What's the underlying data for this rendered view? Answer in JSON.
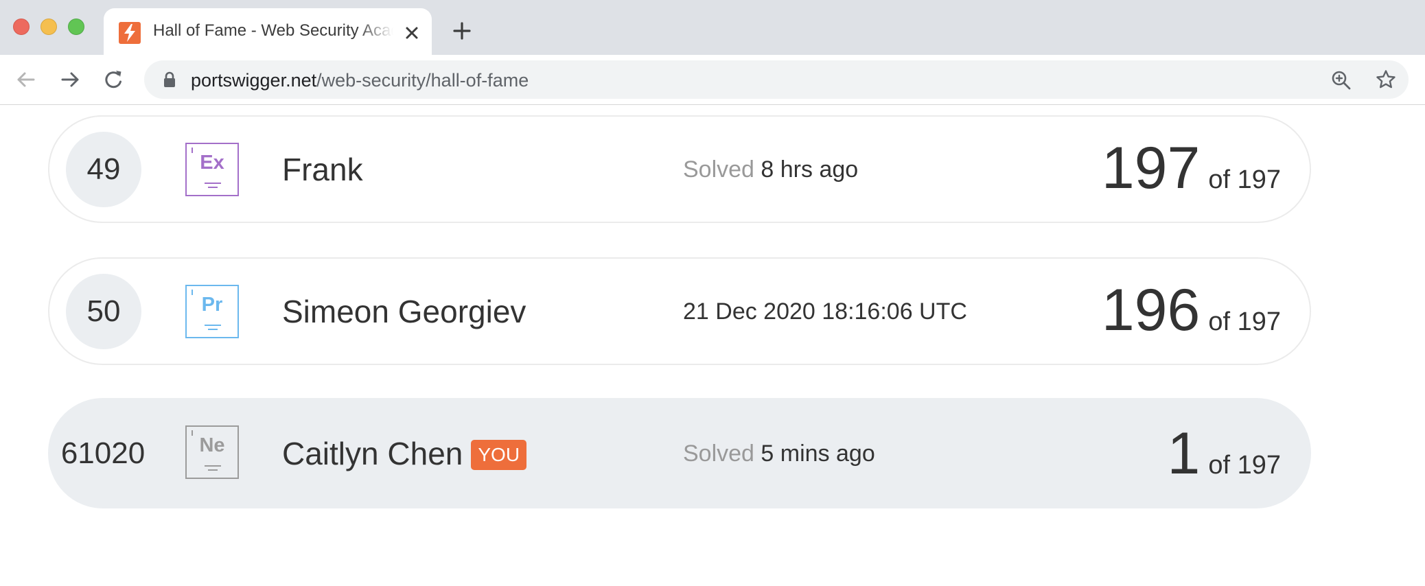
{
  "browser": {
    "tab": {
      "title": "Hall of Fame - Web Security Academy",
      "favicon": "portswigger-icon",
      "accent": "#ee6e3b"
    },
    "address": {
      "host": "portswigger.net",
      "path": "/web-security/hall-of-fame"
    }
  },
  "leaderboard": {
    "rows": [
      {
        "rank": "49",
        "level": {
          "symbol": "Ex",
          "color": "#a36fc9"
        },
        "name": "Frank",
        "solved_prefix": "Solved",
        "solved_value": "8 hrs ago",
        "score": "197",
        "total": "of 197"
      },
      {
        "rank": "50",
        "level": {
          "symbol": "Pr",
          "color": "#6bb8ee"
        },
        "name": "Simeon Georgiev",
        "solved_prefix": "",
        "solved_value": "21 Dec 2020 18:16:06 UTC",
        "score": "196",
        "total": "of 197"
      },
      {
        "rank": "61020",
        "level": {
          "symbol": "Ne",
          "color": "#9b9b9b"
        },
        "name": "Caitlyn Chen",
        "badge": "YOU",
        "solved_prefix": "Solved",
        "solved_value": "5 mins ago",
        "score": "1",
        "total": "of 197"
      }
    ]
  }
}
